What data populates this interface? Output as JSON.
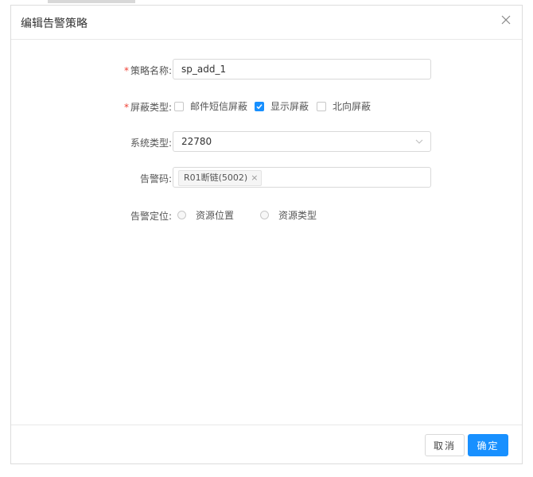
{
  "dialog": {
    "title": "编辑告警策略"
  },
  "form": {
    "required_mark": "*",
    "policy_name": {
      "label": "策略名称:",
      "value": "sp_add_1"
    },
    "mask_type": {
      "label": "屏蔽类型:",
      "options": [
        {
          "label": "邮件短信屏蔽",
          "checked": false
        },
        {
          "label": "显示屏蔽",
          "checked": true
        },
        {
          "label": "北向屏蔽",
          "checked": false
        }
      ]
    },
    "system_type": {
      "label": "系统类型:",
      "value": "22780"
    },
    "alarm_code": {
      "label": "告警码:",
      "tags": [
        {
          "label": "R01断链(5002)",
          "remove": "×"
        }
      ]
    },
    "alarm_location": {
      "label": "告警定位:",
      "options": [
        {
          "label": "资源位置",
          "selected": false
        },
        {
          "label": "资源类型",
          "selected": false
        }
      ]
    }
  },
  "footer": {
    "cancel_label": "取消",
    "ok_label": "确定"
  },
  "colors": {
    "primary": "#1890ff",
    "required": "#f04134",
    "border": "#d9d9d9"
  }
}
